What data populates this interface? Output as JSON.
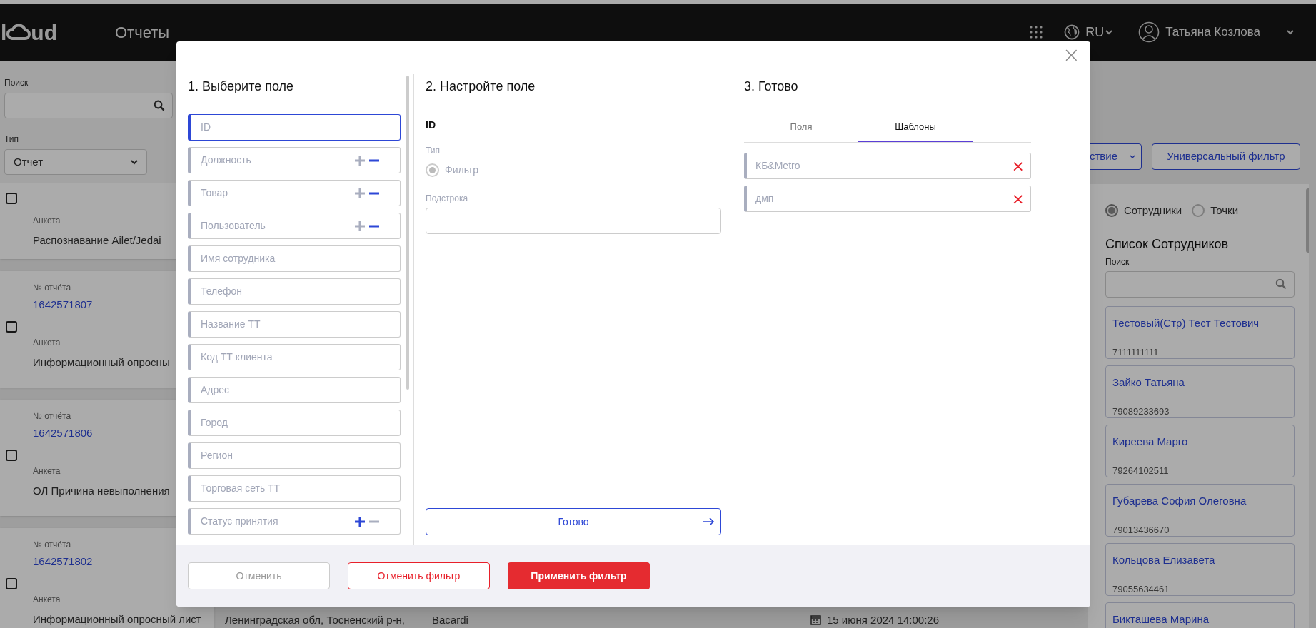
{
  "header": {
    "logo": [
      "l",
      "ud"
    ],
    "title": "Отчеты",
    "language": "RU",
    "user": "Татьяна Козлова"
  },
  "filters": {
    "search_label": "Поиск",
    "type_label": "Тип",
    "type_value": "Отчет"
  },
  "reports": [
    {
      "form_label": "Анкета",
      "form": "Распознавание Ailet/Jedai",
      "checked": false
    },
    {
      "number_label": "№ отчёта",
      "number": "1642571807",
      "form_label": "Анкета",
      "form": "Информационный опросны",
      "checked": false
    },
    {
      "number_label": "№ отчёта",
      "number": "1642571806",
      "form_label": "Анкета",
      "form": "ОЛ Причина невыполнения",
      "checked": false
    },
    {
      "number_label": "№ отчёта",
      "number": "1642571802",
      "form_label": "Анкета",
      "form": "Информационный опросный лист",
      "checked": false
    }
  ],
  "report_row_tail": {
    "address": "Ленинградская обл, Тосненский р-н,",
    "project": "Bacardi",
    "date": "15 июня 2024 14:00:26"
  },
  "toolbar": {
    "action_select": "ствие",
    "universal_filter": "Универсальный фильтр"
  },
  "side_panel": {
    "modes": [
      {
        "label": "Сотрудники",
        "selected": true
      },
      {
        "label": "Точки",
        "selected": false
      }
    ],
    "title": "Список Сотрудников",
    "search_label": "Поиск",
    "employees": [
      {
        "name": "Тестовый(Стр) Тест Тестович",
        "phone": "7111111111"
      },
      {
        "name": "Зайко Татьяна",
        "phone": "79089233693"
      },
      {
        "name": "Киреева Марго",
        "phone": "79264102511"
      },
      {
        "name": "Губарева София Олеговна",
        "phone": "79013436670"
      },
      {
        "name": "Кольцова Елизавета",
        "phone": "79055634461"
      },
      {
        "name": "Бикташева Марина"
      }
    ]
  },
  "modal": {
    "close": "×",
    "step1": {
      "title": "1. Выберите поле",
      "fields": [
        {
          "label": "ID",
          "selected": true
        },
        {
          "label": "Должность",
          "selected": false,
          "kind": "plusminus",
          "included": false
        },
        {
          "label": "Товар",
          "selected": false,
          "kind": "plusminus",
          "included": false
        },
        {
          "label": "Пользователь",
          "selected": false,
          "kind": "plusminus",
          "included": false
        },
        {
          "label": "Имя сотрудника",
          "selected": false
        },
        {
          "label": "Телефон",
          "selected": false
        },
        {
          "label": "Название ТТ",
          "selected": false
        },
        {
          "label": "Код ТТ клиента",
          "selected": false
        },
        {
          "label": "Адрес",
          "selected": false
        },
        {
          "label": "Город",
          "selected": false
        },
        {
          "label": "Регион",
          "selected": false
        },
        {
          "label": "Торговая сеть ТТ",
          "selected": false
        },
        {
          "label": "Статус принятия",
          "selected": false,
          "kind": "plusminus",
          "included": true
        }
      ]
    },
    "step2": {
      "title": "2. Настройте поле",
      "field": "ID",
      "type_label": "Тип",
      "type_option": {
        "label": "Фильтр",
        "selected": true,
        "disabled": true
      },
      "substring_label": "Подстрока",
      "done": "Готово"
    },
    "step3": {
      "title": "3. Готово",
      "tabs": [
        {
          "label": "Поля",
          "selected": false
        },
        {
          "label": "Шаблоны",
          "selected": true
        }
      ],
      "templates": [
        {
          "label": "КБ&Metro",
          "remove": "×"
        },
        {
          "label": "дмп",
          "remove": "×"
        }
      ]
    },
    "footer": {
      "cancel": "Отменить",
      "reset": "Отменить фильтр",
      "apply": "Применить фильтр"
    }
  }
}
